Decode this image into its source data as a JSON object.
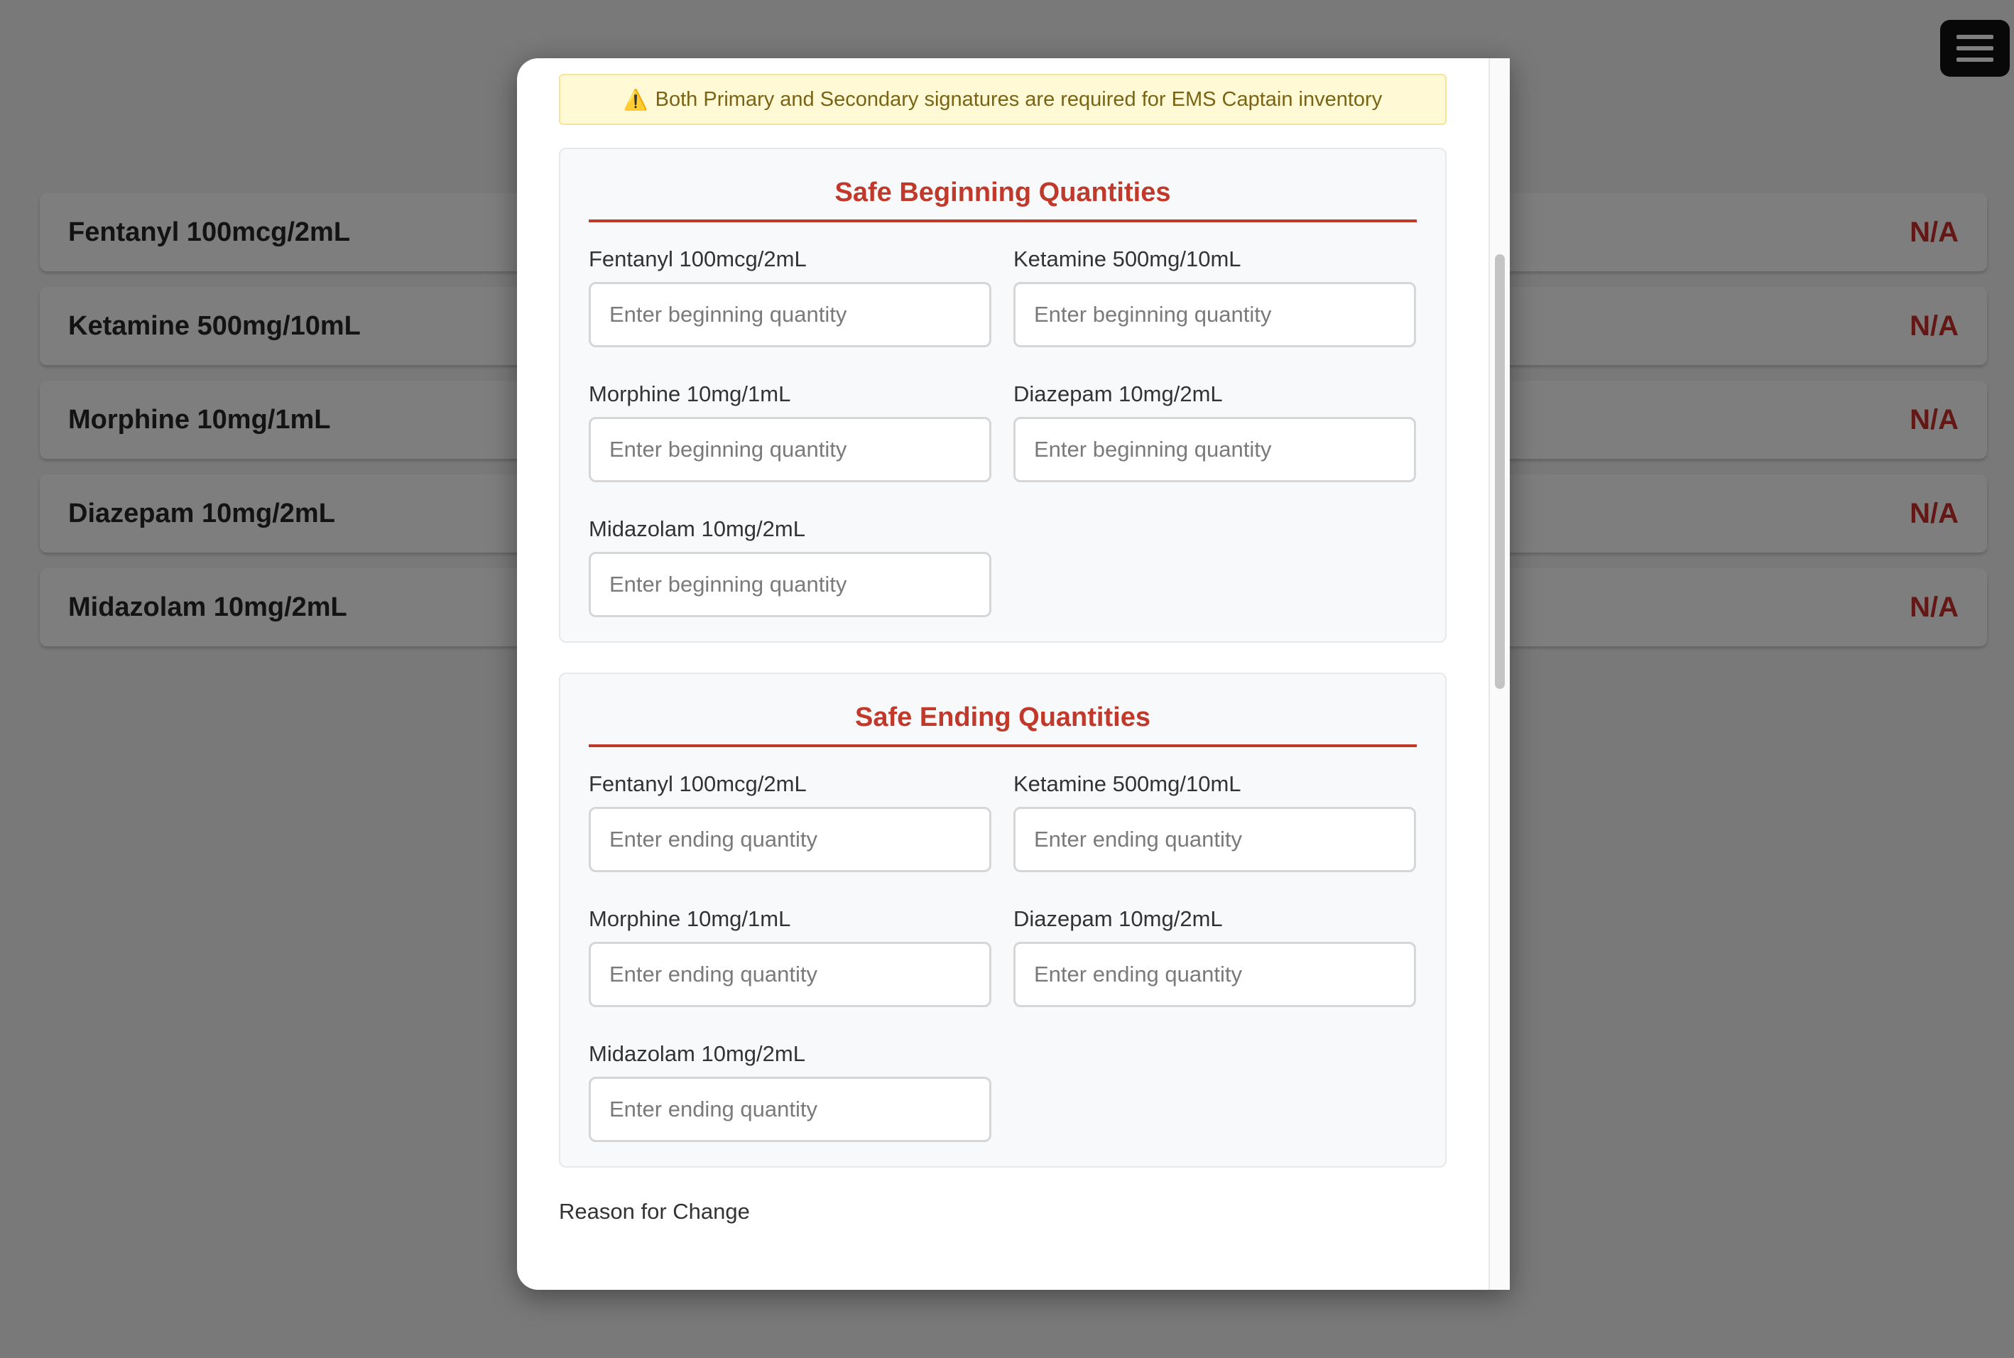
{
  "background": {
    "rows": [
      {
        "medication": "Fentanyl 100mcg/2mL",
        "value": "N/A"
      },
      {
        "medication": "Ketamine 500mg/10mL",
        "value": "N/A"
      },
      {
        "medication": "Morphine 10mg/1mL",
        "value": "N/A"
      },
      {
        "medication": "Diazepam 10mg/2mL",
        "value": "N/A"
      },
      {
        "medication": "Midazolam 10mg/2mL",
        "value": "N/A"
      }
    ],
    "menu_icon": "hamburger-menu-icon"
  },
  "modal": {
    "warning": {
      "icon": "⚠️",
      "text": "Both Primary and Secondary signatures are required for EMS Captain inventory"
    },
    "beginning": {
      "title": "Safe Beginning Quantities",
      "fields": [
        {
          "label": "Fentanyl 100mcg/2mL",
          "placeholder": "Enter beginning quantity",
          "value": ""
        },
        {
          "label": "Ketamine 500mg/10mL",
          "placeholder": "Enter beginning quantity",
          "value": ""
        },
        {
          "label": "Morphine 10mg/1mL",
          "placeholder": "Enter beginning quantity",
          "value": ""
        },
        {
          "label": "Diazepam 10mg/2mL",
          "placeholder": "Enter beginning quantity",
          "value": ""
        },
        {
          "label": "Midazolam 10mg/2mL",
          "placeholder": "Enter beginning quantity",
          "value": ""
        }
      ]
    },
    "ending": {
      "title": "Safe Ending Quantities",
      "fields": [
        {
          "label": "Fentanyl 100mcg/2mL",
          "placeholder": "Enter ending quantity",
          "value": ""
        },
        {
          "label": "Ketamine 500mg/10mL",
          "placeholder": "Enter ending quantity",
          "value": ""
        },
        {
          "label": "Morphine 10mg/1mL",
          "placeholder": "Enter ending quantity",
          "value": ""
        },
        {
          "label": "Diazepam 10mg/2mL",
          "placeholder": "Enter ending quantity",
          "value": ""
        },
        {
          "label": "Midazolam 10mg/2mL",
          "placeholder": "Enter ending quantity",
          "value": ""
        }
      ]
    },
    "reason_label": "Reason for Change"
  },
  "colors": {
    "accent_red": "#c0392b",
    "warning_bg": "#fff9d6",
    "warning_text": "#7a6414"
  }
}
